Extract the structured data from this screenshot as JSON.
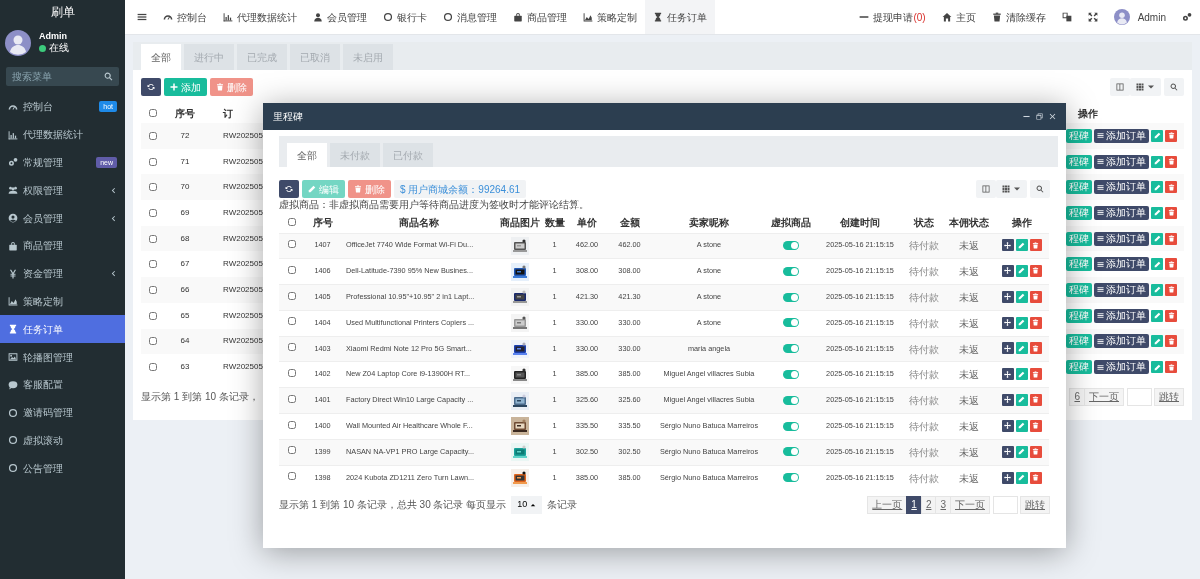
{
  "sidebar": {
    "title": "刷单",
    "user": {
      "name": "Admin",
      "status": "在线",
      "online": true
    },
    "search": {
      "placeholder": "搜索菜单"
    },
    "items": [
      {
        "label": "控制台",
        "badge": {
          "text": "hot",
          "color": "#1e8ae8"
        },
        "expandable": false,
        "selected": false
      },
      {
        "label": "代理数据统计",
        "expandable": false,
        "selected": false
      },
      {
        "label": "常规管理",
        "badge": {
          "text": "new",
          "color": "#605ca8"
        },
        "expandable": false,
        "selected": false
      },
      {
        "label": "权限管理",
        "expandable": true,
        "selected": false
      },
      {
        "label": "会员管理",
        "expandable": true,
        "selected": false
      },
      {
        "label": "商品管理",
        "expandable": false,
        "selected": false
      },
      {
        "label": "资金管理",
        "expandable": true,
        "selected": false
      },
      {
        "label": "策略定制",
        "expandable": false,
        "selected": false
      },
      {
        "label": "任务订单",
        "expandable": false,
        "selected": true
      },
      {
        "label": "轮播图管理",
        "expandable": false,
        "selected": false
      },
      {
        "label": "客服配置",
        "expandable": false,
        "selected": false
      },
      {
        "label": "邀请码管理",
        "expandable": false,
        "selected": false
      },
      {
        "label": "虚拟滚动",
        "expandable": false,
        "selected": false
      },
      {
        "label": "公告管理",
        "expandable": false,
        "selected": false
      }
    ]
  },
  "topbar": {
    "tabs": [
      {
        "label": "控制台",
        "selected": false
      },
      {
        "label": "代理数据统计",
        "selected": false
      },
      {
        "label": "会员管理",
        "selected": false
      },
      {
        "label": "银行卡",
        "selected": false
      },
      {
        "label": "消息管理",
        "selected": false
      },
      {
        "label": "商品管理",
        "selected": false
      },
      {
        "label": "策略定制",
        "selected": false
      },
      {
        "label": "任务订单",
        "selected": true
      }
    ],
    "withdraw": {
      "label": "提现申请",
      "count": "(0)"
    },
    "home": "主页",
    "clear_cache": "清除缓存",
    "user": "Admin"
  },
  "page": {
    "tabs": [
      {
        "label": "全部",
        "selected": true
      },
      {
        "label": "进行中",
        "selected": false
      },
      {
        "label": "已完成",
        "selected": false
      },
      {
        "label": "已取消",
        "selected": false
      },
      {
        "label": "未启用",
        "selected": false
      }
    ],
    "toolbar": {
      "add": {
        "label": "添加",
        "disabled": false
      },
      "delete": {
        "label": "删除",
        "disabled": true
      }
    },
    "all_checked": false,
    "columns": [
      "序号",
      "订"
    ],
    "ops_column": "操作",
    "rows": [
      {
        "id": "72",
        "order": "RW202505",
        "checked": false,
        "actions": [
          "程碑",
          "添加订单"
        ]
      },
      {
        "id": "71",
        "order": "RW202505",
        "checked": false,
        "actions": [
          "程碑",
          "添加订单"
        ]
      },
      {
        "id": "70",
        "order": "RW202505",
        "checked": false,
        "actions": [
          "程碑",
          "添加订单"
        ]
      },
      {
        "id": "69",
        "order": "RW202505",
        "checked": false,
        "actions": [
          "程碑",
          "添加订单"
        ]
      },
      {
        "id": "68",
        "order": "RW202505",
        "checked": false,
        "actions": [
          "程碑",
          "添加订单"
        ]
      },
      {
        "id": "67",
        "order": "RW202505",
        "checked": false,
        "actions": [
          "程碑",
          "添加订单"
        ]
      },
      {
        "id": "66",
        "order": "RW202505",
        "checked": false,
        "actions": [
          "程碑",
          "添加订单"
        ]
      },
      {
        "id": "65",
        "order": "RW202505",
        "checked": false,
        "actions": [
          "程碑",
          "添加订单"
        ]
      },
      {
        "id": "64",
        "order": "RW202505",
        "checked": false,
        "actions": [
          "程碑",
          "添加订单"
        ]
      },
      {
        "id": "63",
        "order": "RW202505",
        "checked": false,
        "actions": [
          "程碑",
          "添加订单"
        ]
      }
    ],
    "summary": "显示第 1 到第 10 条记录，",
    "pagination": [
      {
        "label": "6",
        "selected": false
      },
      {
        "label": "下一页",
        "selected": false
      }
    ],
    "jump": "跳转"
  },
  "modal": {
    "title": "里程碑",
    "tabs": [
      {
        "label": "全部",
        "selected": true
      },
      {
        "label": "未付款",
        "selected": false
      },
      {
        "label": "已付款",
        "selected": false
      }
    ],
    "toolbar": {
      "edit": {
        "label": "编辑",
        "disabled": true
      },
      "delete": {
        "label": "删除",
        "disabled": true
      },
      "balance": "$ 用户商城余额：99264.61"
    },
    "note": "虚拟商品：非虚拟商品需要用户等待商品进度为签收时才能评论结算。",
    "all_checked": false,
    "columns": [
      "序号",
      "商品名称",
      "商品图片",
      "数量",
      "单价",
      "金额",
      "卖家昵称",
      "虚拟商品",
      "创建时间",
      "状态",
      "本佣状态",
      "操作"
    ],
    "rows": [
      {
        "id": "1407",
        "name": "OfficeJet 7740 Wide Format Wi-Fi Du...",
        "qty": "1",
        "price": "462.00",
        "amount": "462.00",
        "seller": "A stone",
        "virtual": true,
        "created": "2025-05-16 21:15:15",
        "status": "待付款",
        "commission": "未返",
        "checked": false
      },
      {
        "id": "1406",
        "name": "Dell-Latitude-7390 95% New Busines...",
        "qty": "1",
        "price": "308.00",
        "amount": "308.00",
        "seller": "A stone",
        "virtual": true,
        "created": "2025-05-16 21:15:15",
        "status": "待付款",
        "commission": "未返",
        "checked": false
      },
      {
        "id": "1405",
        "name": "Professional 10.95\"+10.95\" 2 in1 Lapt...",
        "qty": "1",
        "price": "421.30",
        "amount": "421.30",
        "seller": "A stone",
        "virtual": true,
        "created": "2025-05-16 21:15:15",
        "status": "待付款",
        "commission": "未返",
        "checked": false
      },
      {
        "id": "1404",
        "name": "Used Multifunctional Printers Copiers ...",
        "qty": "1",
        "price": "330.00",
        "amount": "330.00",
        "seller": "A stone",
        "virtual": true,
        "created": "2025-05-16 21:15:15",
        "status": "待付款",
        "commission": "未返",
        "checked": false
      },
      {
        "id": "1403",
        "name": "Xiaomi Redmi Note 12 Pro 5G Smart...",
        "qty": "1",
        "price": "330.00",
        "amount": "330.00",
        "seller": "maria angela",
        "virtual": true,
        "created": "2025-05-16 21:15:15",
        "status": "待付款",
        "commission": "未返",
        "checked": false
      },
      {
        "id": "1402",
        "name": "New Z04 Laptop Core i9-13900H RT...",
        "qty": "1",
        "price": "385.00",
        "amount": "385.00",
        "seller": "Miguel Angel villacres Subia",
        "virtual": true,
        "created": "2025-05-16 21:15:15",
        "status": "待付款",
        "commission": "未返",
        "checked": false
      },
      {
        "id": "1401",
        "name": "Factory Direct Win10 Large Capacity ...",
        "qty": "1",
        "price": "325.60",
        "amount": "325.60",
        "seller": "Miguel Angel villacres Subia",
        "virtual": true,
        "created": "2025-05-16 21:15:15",
        "status": "待付款",
        "commission": "未返",
        "checked": false
      },
      {
        "id": "1400",
        "name": "Wall Mounted Air Healthcare Whole F...",
        "qty": "1",
        "price": "335.50",
        "amount": "335.50",
        "seller": "Sérgio Nuno Batuca Marreiros",
        "virtual": true,
        "created": "2025-05-16 21:15:15",
        "status": "待付款",
        "commission": "未返",
        "checked": false
      },
      {
        "id": "1399",
        "name": "NASAN NA-VP1 PRO Large Capacity...",
        "qty": "1",
        "price": "302.50",
        "amount": "302.50",
        "seller": "Sérgio Nuno Batuca Marreiros",
        "virtual": true,
        "created": "2025-05-16 21:15:15",
        "status": "待付款",
        "commission": "未返",
        "checked": false
      },
      {
        "id": "1398",
        "name": "2024 Kubota ZD1211 Zero Turn Lawn...",
        "qty": "1",
        "price": "385.00",
        "amount": "385.00",
        "seller": "Sérgio Nuno Batuca Marreiros",
        "virtual": true,
        "created": "2025-05-16 21:15:15",
        "status": "待付款",
        "commission": "未返",
        "checked": false
      }
    ],
    "summary": "显示第 1 到第 10 条记录，总共 30 条记录 每页显示",
    "page_size": "10",
    "page_size_suffix": "条记录",
    "pagination": [
      {
        "label": "上一页",
        "selected": false
      },
      {
        "label": "1",
        "selected": true
      },
      {
        "label": "2",
        "selected": false
      },
      {
        "label": "3",
        "selected": false
      },
      {
        "label": "下一页",
        "selected": false
      }
    ],
    "jump": "跳转"
  }
}
